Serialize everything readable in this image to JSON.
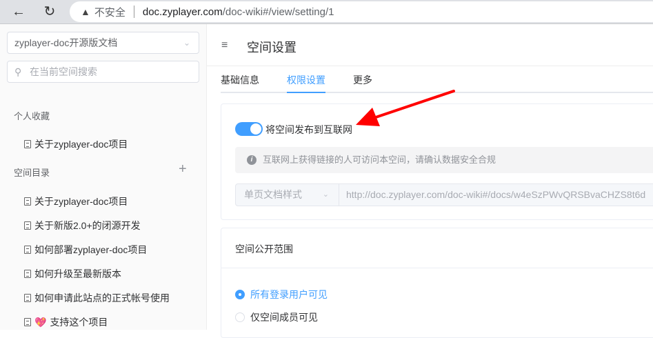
{
  "browser": {
    "insecure_label": "不安全",
    "url_host": "doc.zyplayer.com",
    "url_path": "/doc-wiki#/view/setting/1"
  },
  "sidebar": {
    "space_select": "zyplayer-doc开源版文档",
    "search_placeholder": "在当前空间搜索",
    "favorites_title": "个人收藏",
    "favorites": [
      "关于zyplayer-doc项目"
    ],
    "catalog_title": "空间目录",
    "add_label": "+",
    "catalog": [
      "关于zyplayer-doc项目",
      "关于新版2.0+的闭源开发",
      "如何部署zyplayer-doc项目",
      "如何升级至最新版本",
      "如何申请此站点的正式帐号使用",
      "支持这个项目"
    ],
    "heart_emoji": "💖"
  },
  "header": {
    "title": "空间设置"
  },
  "tabs": [
    "基础信息",
    "权限设置",
    "更多"
  ],
  "publish": {
    "toggle_label": "将空间发布到互联网",
    "toggle_on": true,
    "alert": "互联网上获得链接的人可访问本空间，请确认数据安全合规",
    "style_select": "单页文档样式",
    "public_url": "http://doc.zyplayer.com/doc-wiki#/docs/w4eSzPWvQRSBvaCHZS8t6d"
  },
  "scope": {
    "title": "空间公开范围",
    "options": [
      "所有登录用户可见",
      "仅空间成员可见"
    ],
    "selected": 0
  },
  "colors": {
    "accent": "#409eff",
    "arrow": "#ff0000"
  }
}
